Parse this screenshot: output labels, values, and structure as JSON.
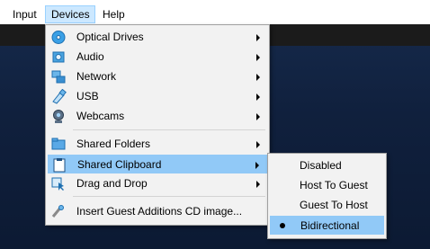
{
  "menubar": {
    "items": [
      {
        "label": "Input"
      },
      {
        "label": "Devices"
      },
      {
        "label": "Help"
      }
    ]
  },
  "devices_menu": {
    "items": [
      {
        "label": "Optical Drives",
        "icon": "optical-disc-icon",
        "submenu": true
      },
      {
        "label": "Audio",
        "icon": "audio-icon",
        "submenu": true
      },
      {
        "label": "Network",
        "icon": "network-icon",
        "submenu": true
      },
      {
        "label": "USB",
        "icon": "usb-icon",
        "submenu": true
      },
      {
        "label": "Webcams",
        "icon": "webcam-icon",
        "submenu": true
      },
      {
        "label": "Shared Folders",
        "icon": "folder-icon",
        "submenu": true
      },
      {
        "label": "Shared Clipboard",
        "icon": "clipboard-icon",
        "submenu": true,
        "highlighted": true
      },
      {
        "label": "Drag and Drop",
        "icon": "drag-drop-icon",
        "submenu": true
      },
      {
        "label": "Insert Guest Additions CD image...",
        "icon": "cd-insert-icon",
        "submenu": false
      }
    ]
  },
  "clipboard_submenu": {
    "items": [
      {
        "label": "Disabled",
        "selected": false
      },
      {
        "label": "Host To Guest",
        "selected": false
      },
      {
        "label": "Guest To Host",
        "selected": false
      },
      {
        "label": "Bidirectional",
        "selected": true
      }
    ]
  },
  "colors": {
    "highlight": "#91c9f7",
    "menu_bg": "#f2f2f2",
    "menubar_active": "#cce8ff",
    "vm_background": "#10203d"
  }
}
